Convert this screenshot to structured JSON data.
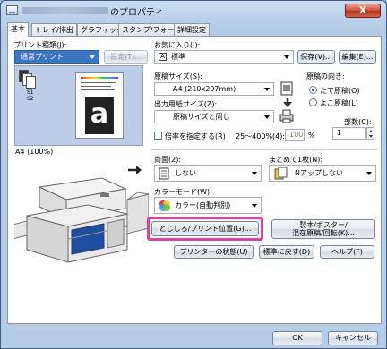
{
  "window": {
    "title": "のプロパティ",
    "close_label": "X"
  },
  "tabs": [
    "基本",
    "トレイ/排出",
    "グラフィックス",
    "スタンプ/フォーム",
    "詳細設定"
  ],
  "left": {
    "printer_type_label": "プリント種類(J):",
    "printer_type_value": "通常プリント",
    "settings_button": "設定(T)...",
    "paper_info": "A4 (100%)",
    "preview_glyph": "a",
    "mini_page_labels": [
      "S1",
      "S2"
    ]
  },
  "favorites": {
    "label": "お気に入り(I):",
    "value": "標準",
    "save_button": "保存(V)...",
    "edit_button": "編集(E)..."
  },
  "paper": {
    "size_label": "原稿サイズ(S):",
    "size_value": "A4 (210x297mm)",
    "output_label": "出力用紙サイズ(Z):",
    "output_value": "原稿サイズと同じ",
    "scale_label": "倍率を指定する(R)",
    "scale_range": "25〜400%(4):",
    "scale_value": "100",
    "scale_unit": "%"
  },
  "orientation": {
    "label": "原稿の向き:",
    "portrait": "たて原稿(O)",
    "landscape": "よこ原稿(L)"
  },
  "copies": {
    "label": "部数(C):",
    "value": "1"
  },
  "duplex": {
    "label": "両面(2):",
    "value": "しない"
  },
  "nup": {
    "label": "まとめて1枚(N):",
    "value": "Nアップしない"
  },
  "color_mode": {
    "label": "カラーモード(W):",
    "value": "カラー(自動判別)"
  },
  "buttons": {
    "binding": "とじしろ/プリント位置(G)...",
    "booklet_line1": "製本/ポスター/",
    "booklet_line2": "混在原稿/回転(K)...",
    "printer_status": "プリンターの状態(U)",
    "restore_defaults": "標準に戻す(D)",
    "help": "ヘルプ(F)"
  },
  "footer": {
    "ok": "OK",
    "cancel": "キャンセル"
  },
  "colors": {
    "highlight": "#df3fa6",
    "selection": "#3a76c4"
  }
}
